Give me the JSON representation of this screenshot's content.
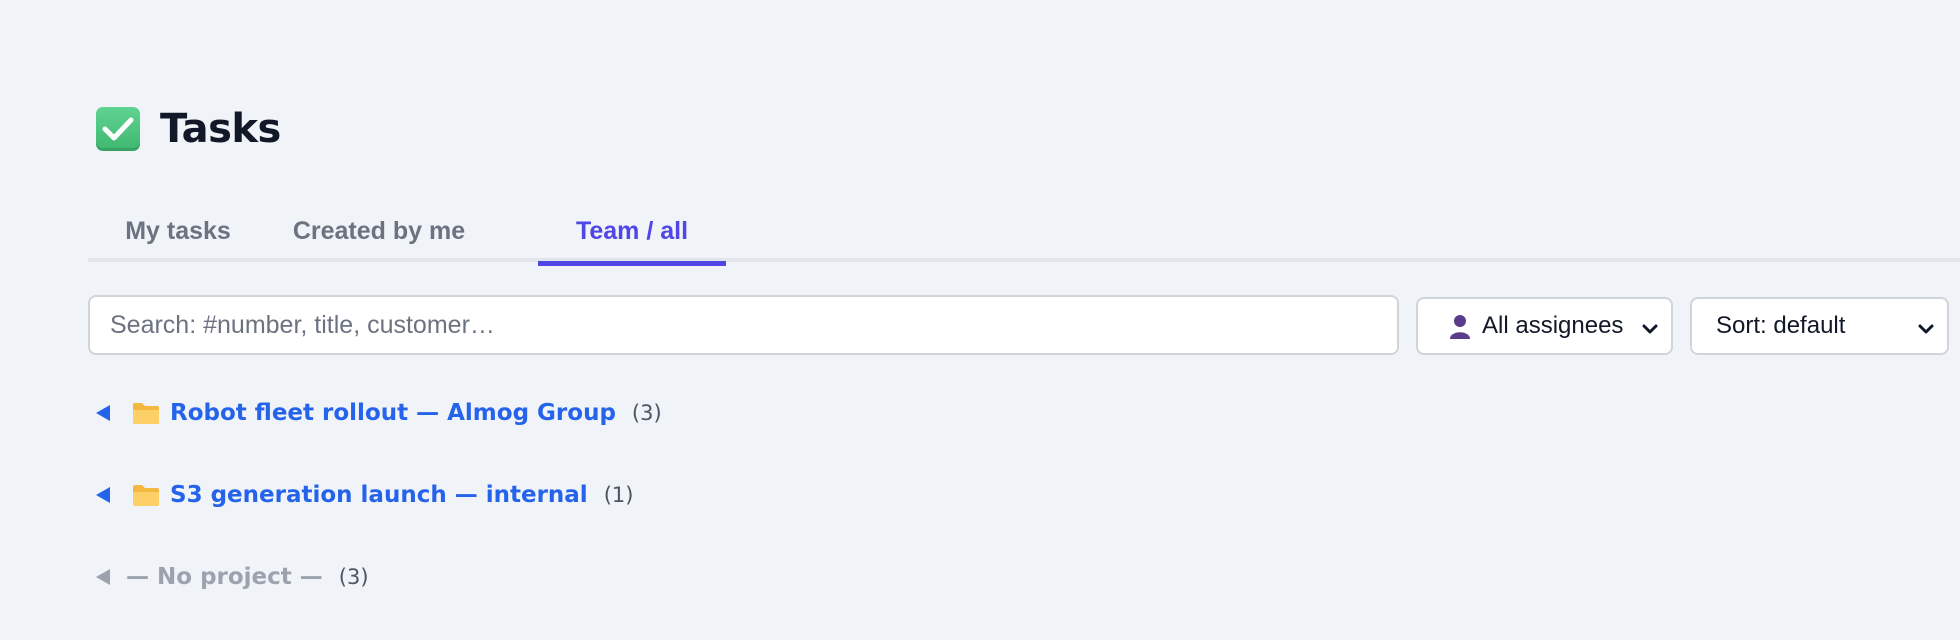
{
  "page": {
    "title": "Tasks"
  },
  "icons": {
    "title": "check-box-icon",
    "assignee": "person-icon",
    "group": "folder-icon",
    "dropdown": "chevron-down-icon",
    "toggle": "triangle-left-icon"
  },
  "colors": {
    "accent": "#4f46e5",
    "link": "#2563eb",
    "check": "#3fb870",
    "muted": "#9ca3af"
  },
  "tabs": [
    {
      "label": "My tasks",
      "active": false
    },
    {
      "label": "Created by me",
      "active": false
    },
    {
      "label": "Team / all",
      "active": true
    }
  ],
  "search": {
    "placeholder": "Search: #number, title, customer…",
    "value": ""
  },
  "filters": {
    "assignee": {
      "label": "All assignees"
    },
    "sort": {
      "label": "Sort: default"
    }
  },
  "groups": [
    {
      "name": "Robot fleet rollout — Almog Group",
      "count": "(3)"
    },
    {
      "name": "S3 generation launch — internal",
      "count": "(1)"
    },
    {
      "name": "— No project —",
      "count": "(3)"
    }
  ]
}
